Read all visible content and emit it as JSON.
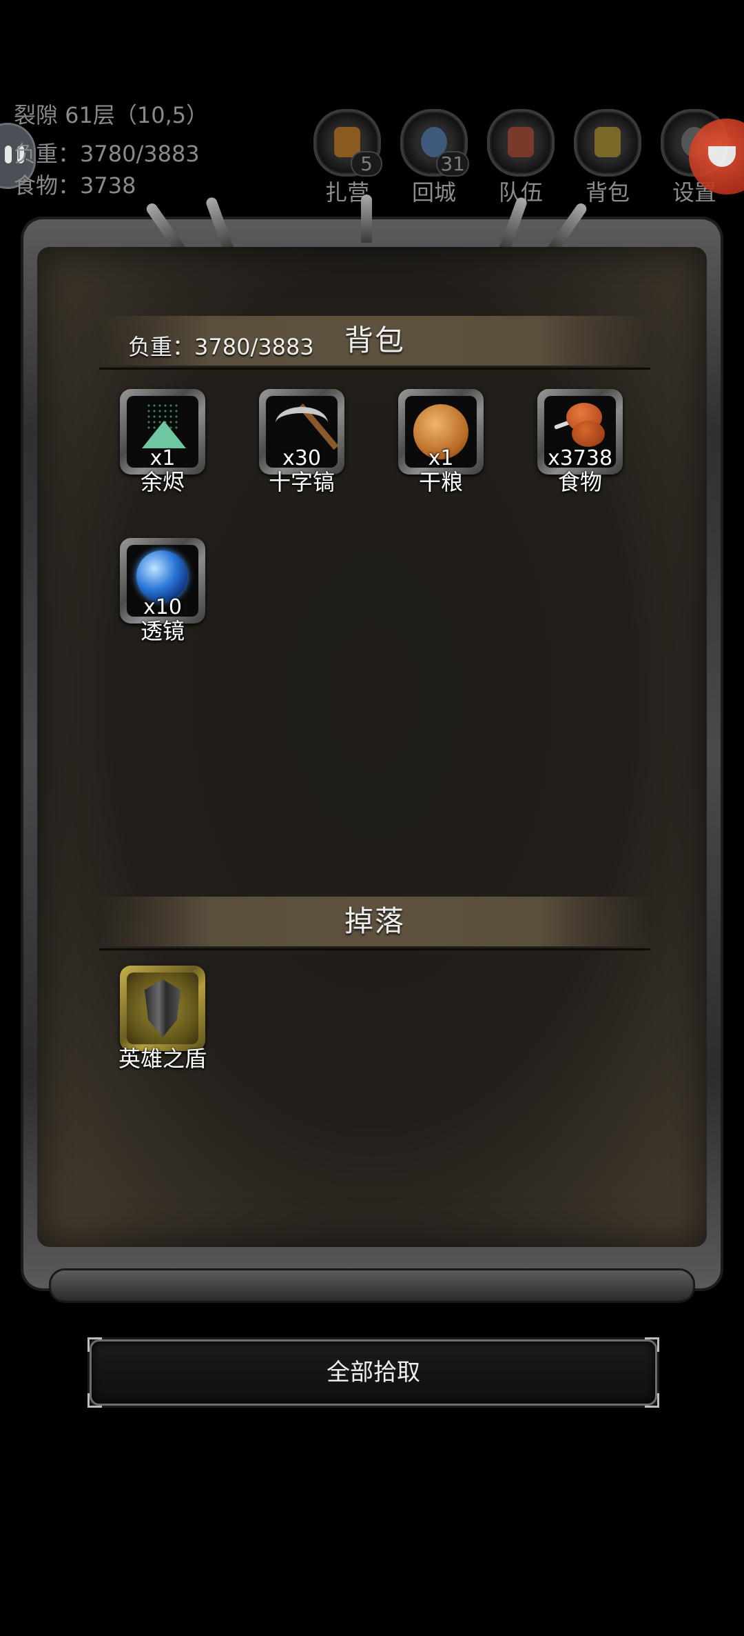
{
  "hud": {
    "location": "裂隙 61层（10,5）",
    "weight_label": "负重：3780/3883",
    "food_label": "食物：3738"
  },
  "top_menu": [
    {
      "label": "扎营",
      "icon": "campfire-icon",
      "badge": "5",
      "color": "#8a5a20"
    },
    {
      "label": "回城",
      "icon": "portal-icon",
      "badge": "31",
      "color": "#3d5a7a"
    },
    {
      "label": "队伍",
      "icon": "team-icon",
      "badge": "",
      "color": "#7a3a2a"
    },
    {
      "label": "背包",
      "icon": "backpack-icon",
      "badge": "",
      "color": "#7a6a2a"
    },
    {
      "label": "设置",
      "icon": "gear-icon",
      "badge": "",
      "color": "#555555"
    }
  ],
  "bag": {
    "title": "背包",
    "weight": "负重：3780/3883",
    "items": [
      {
        "name": "余烬",
        "count": "x1",
        "icon": "ember-icon"
      },
      {
        "name": "十字镐",
        "count": "x30",
        "icon": "pickaxe-icon"
      },
      {
        "name": "干粮",
        "count": "x1",
        "icon": "ration-icon"
      },
      {
        "name": "食物",
        "count": "x3738",
        "icon": "meat-icon"
      },
      {
        "name": "透镜",
        "count": "x10",
        "icon": "lens-icon"
      }
    ]
  },
  "drops": {
    "title": "掉落",
    "items": [
      {
        "name": "英雄之盾",
        "count": "",
        "icon": "shield-icon",
        "rarity": "gold"
      }
    ]
  },
  "actions": {
    "pick_all": "全部拾取"
  }
}
